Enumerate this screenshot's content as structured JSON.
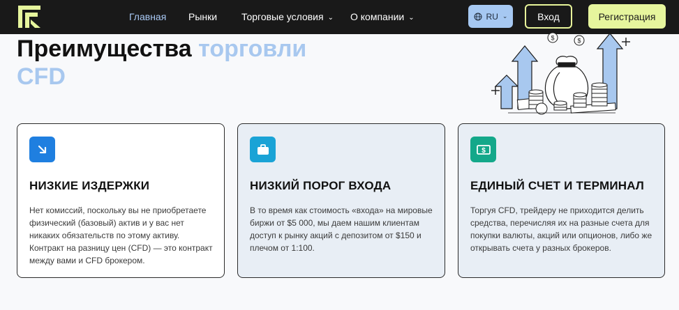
{
  "header": {
    "nav": [
      {
        "label": "Главная",
        "active": true
      },
      {
        "label": "Рынки"
      },
      {
        "label": "Торговые условия",
        "dropdown": true
      },
      {
        "label": "О компании",
        "dropdown": true
      }
    ],
    "language": "RU",
    "login_label": "Вход",
    "register_label": "Регистрация"
  },
  "hero": {
    "title_dark": "Преимущества",
    "title_light_1": "торговли",
    "title_light_2": "CFD"
  },
  "cards": [
    {
      "icon": "arrow-down-right-icon",
      "icon_color": "#1f7fe0",
      "title": "НИЗКИЕ ИЗДЕРЖКИ",
      "text": "Нет комиссий, поскольку вы не приобретаете физический (базовый) актив и у вас нет никаких обязательств по этому активу. Контракт на разницу цен (CFD) — это контракт между вами и CFD брокером."
    },
    {
      "icon": "briefcase-icon",
      "icon_color": "#1aa3d6",
      "title": "НИЗКИЙ ПОРОГ ВХОДА",
      "text": "В то время как стоимость «входа» на мировые биржи от $5 000, мы даем нашим клиентам доступ к рынку акций с депозитом от $150 и плечом от 1:100."
    },
    {
      "icon": "banknote-icon",
      "icon_color": "#14a88a",
      "title": "ЕДИНЫЙ СЧЕТ И ТЕРМИНАЛ",
      "text": "Торгуя CFD, трейдеру не приходится делить средства, перечисляя их на разные счета для покупки валюты, акций или опционов, либо же открывать счета у разных брокеров."
    }
  ],
  "colors": {
    "header_bg": "#191919",
    "accent_lime": "#e6f59d",
    "accent_blue": "#a8c8ef"
  }
}
